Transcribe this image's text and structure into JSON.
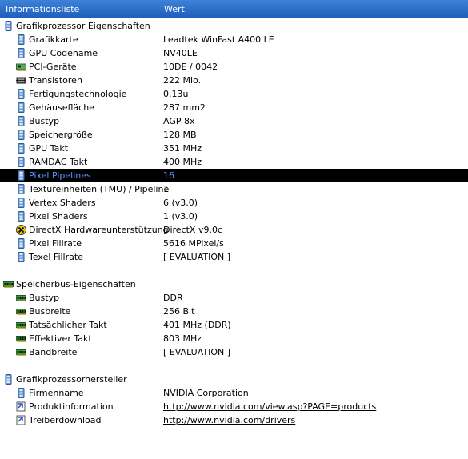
{
  "columns": {
    "name": "Informationsliste",
    "value": "Wert"
  },
  "sections": [
    {
      "title": "Grafikprozessor Eigenschaften",
      "icon": "gpu-chip-icon",
      "items": [
        {
          "label": "Grafikkarte",
          "value": "Leadtek WinFast A400 LE",
          "icon": "gpu-chip-icon"
        },
        {
          "label": "GPU Codename",
          "value": "NV40LE",
          "icon": "gpu-chip-icon"
        },
        {
          "label": "PCI-Geräte",
          "value": "10DE / 0042",
          "icon": "pci-card-icon"
        },
        {
          "label": "Transistoren",
          "value": "222 Mio.",
          "icon": "processor-icon"
        },
        {
          "label": "Fertigungstechnologie",
          "value": "0.13u",
          "icon": "gpu-chip-icon"
        },
        {
          "label": "Gehäusefläche",
          "value": "287 mm2",
          "icon": "gpu-chip-icon"
        },
        {
          "label": "Bustyp",
          "value": "AGP 8x",
          "icon": "gpu-chip-icon"
        },
        {
          "label": "Speichergröße",
          "value": "128 MB",
          "icon": "gpu-chip-icon"
        },
        {
          "label": "GPU Takt",
          "value": "351 MHz",
          "icon": "gpu-chip-icon"
        },
        {
          "label": "RAMDAC Takt",
          "value": "400 MHz",
          "icon": "gpu-chip-icon"
        },
        {
          "label": "Pixel Pipelines",
          "value": "16",
          "icon": "gpu-chip-icon",
          "selected": true
        },
        {
          "label": "Textureinheiten (TMU) / Pipeline",
          "value": "1",
          "icon": "gpu-chip-icon"
        },
        {
          "label": "Vertex Shaders",
          "value": "6  (v3.0)",
          "icon": "gpu-chip-icon"
        },
        {
          "label": "Pixel Shaders",
          "value": "1  (v3.0)",
          "icon": "gpu-chip-icon"
        },
        {
          "label": "DirectX Hardwareunterstützung",
          "value": "DirectX v9.0c",
          "icon": "directx-icon"
        },
        {
          "label": "Pixel Fillrate",
          "value": "5616 MPixel/s",
          "icon": "gpu-chip-icon"
        },
        {
          "label": "Texel Fillrate",
          "value": "[ EVALUATION ]",
          "icon": "gpu-chip-icon"
        }
      ]
    },
    {
      "title": "Speicherbus-Eigenschaften",
      "icon": "memory-module-icon",
      "items": [
        {
          "label": "Bustyp",
          "value": "DDR",
          "icon": "memory-module-icon"
        },
        {
          "label": "Busbreite",
          "value": "256 Bit",
          "icon": "memory-module-icon"
        },
        {
          "label": "Tatsächlicher Takt",
          "value": "401 MHz (DDR)",
          "icon": "memory-module-icon"
        },
        {
          "label": "Effektiver Takt",
          "value": "803 MHz",
          "icon": "memory-module-icon"
        },
        {
          "label": "Bandbreite",
          "value": "[ EVALUATION ]",
          "icon": "memory-module-icon"
        }
      ]
    },
    {
      "title": "Grafikprozessorhersteller",
      "icon": "gpu-chip-icon",
      "items": [
        {
          "label": "Firmenname",
          "value": "NVIDIA Corporation",
          "icon": "gpu-chip-icon"
        },
        {
          "label": "Produktinformation",
          "value": "http://www.nvidia.com/view.asp?PAGE=products",
          "icon": "link-icon",
          "link": true
        },
        {
          "label": "Treiberdownload",
          "value": "http://www.nvidia.com/drivers",
          "icon": "link-icon",
          "link": true
        }
      ]
    }
  ]
}
